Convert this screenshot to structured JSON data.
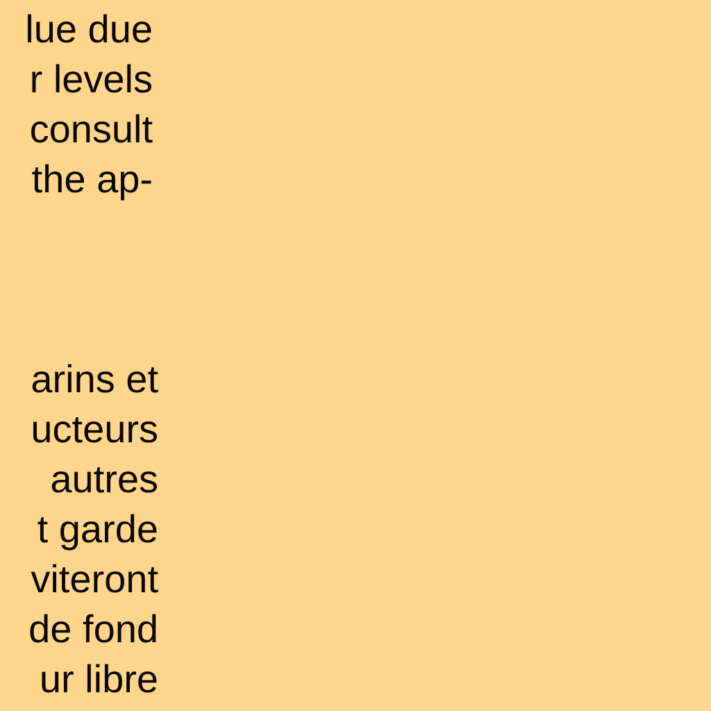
{
  "background_color": "#ffd58c",
  "text_color": "#0a0805",
  "english_lines": [
    "lue due",
    "r levels",
    " consult",
    " the ap-"
  ],
  "french_lines": [
    "arins et",
    "ucteurs",
    " autres",
    "t garde",
    "viteront",
    "de fond",
    "ur libre"
  ]
}
